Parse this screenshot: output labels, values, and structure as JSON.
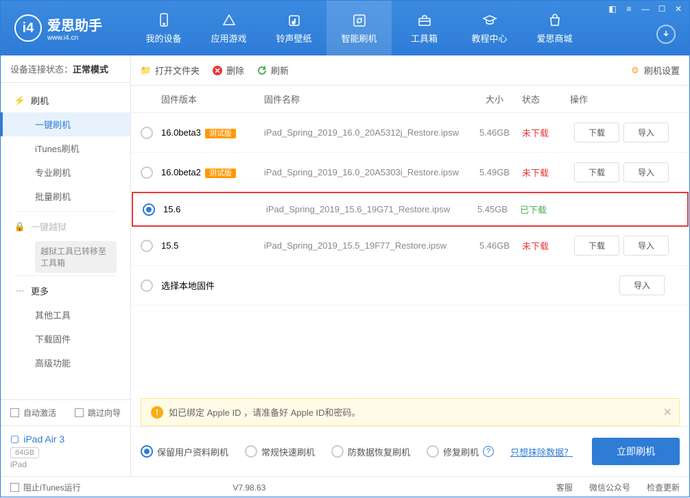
{
  "app": {
    "name": "爱思助手",
    "url": "www.i4.cn"
  },
  "nav": {
    "items": [
      {
        "label": "我的设备"
      },
      {
        "label": "应用游戏"
      },
      {
        "label": "铃声壁纸"
      },
      {
        "label": "智能刷机"
      },
      {
        "label": "工具箱"
      },
      {
        "label": "教程中心"
      },
      {
        "label": "爱思商城"
      }
    ]
  },
  "sidebar": {
    "status_label": "设备连接状态：",
    "status_value": "正常模式",
    "flash_header": "刷机",
    "items": [
      "一键刷机",
      "iTunes刷机",
      "专业刷机",
      "批量刷机"
    ],
    "jailbreak_header": "一键越狱",
    "jailbreak_note": "越狱工具已转移至工具箱",
    "more_header": "更多",
    "more_items": [
      "其他工具",
      "下载固件",
      "高级功能"
    ],
    "auto_activate": "自动激活",
    "skip_guide": "跳过向导",
    "device_name": "iPad Air 3",
    "device_storage": "64GB",
    "device_type": "iPad"
  },
  "toolbar": {
    "open": "打开文件夹",
    "delete": "删除",
    "refresh": "刷新",
    "settings": "刷机设置"
  },
  "table": {
    "headers": {
      "version": "固件版本",
      "name": "固件名称",
      "size": "大小",
      "status": "状态",
      "ops": "操作"
    },
    "download_btn": "下载",
    "import_btn": "导入",
    "beta_label": "测试版",
    "select_local": "选择本地固件",
    "rows": [
      {
        "version": "16.0beta3",
        "beta": true,
        "name": "iPad_Spring_2019_16.0_20A5312j_Restore.ipsw",
        "size": "5.46GB",
        "status": "未下载",
        "downloaded": false,
        "selected": false
      },
      {
        "version": "16.0beta2",
        "beta": true,
        "name": "iPad_Spring_2019_16.0_20A5303i_Restore.ipsw",
        "size": "5.49GB",
        "status": "未下载",
        "downloaded": false,
        "selected": false
      },
      {
        "version": "15.6",
        "beta": false,
        "name": "iPad_Spring_2019_15.6_19G71_Restore.ipsw",
        "size": "5.45GB",
        "status": "已下载",
        "downloaded": true,
        "selected": true
      },
      {
        "version": "15.5",
        "beta": false,
        "name": "iPad_Spring_2019_15.5_19F77_Restore.ipsw",
        "size": "5.46GB",
        "status": "未下载",
        "downloaded": false,
        "selected": false
      }
    ]
  },
  "warning": "如已绑定 Apple ID ，请准备好 Apple ID和密码。",
  "options": {
    "keep_data": "保留用户资料刷机",
    "normal": "常规快速刷机",
    "anti_recovery": "防数据恢复刷机",
    "repair": "修复刷机",
    "erase_link": "只想抹除数据？",
    "flash_btn": "立即刷机"
  },
  "footer": {
    "block_itunes": "阻止iTunes运行",
    "version": "V7.98.63",
    "service": "客服",
    "wechat": "微信公众号",
    "check_update": "检查更新"
  }
}
